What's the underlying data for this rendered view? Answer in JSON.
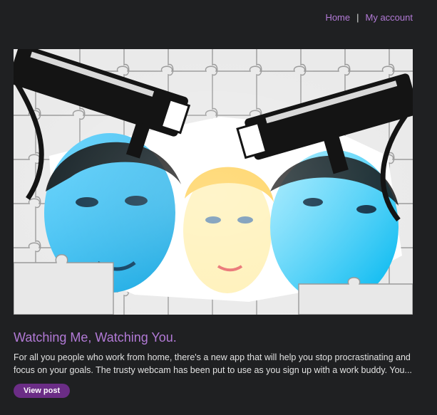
{
  "nav": {
    "home_label": "Home",
    "separator": "|",
    "account_label": "My account"
  },
  "post": {
    "title": "Watching Me, Watching You.",
    "excerpt": "For all you people who work from home, there's a new app that will help you stop procrastinating and focus on your goals. The trusty webcam has been put to use as you sign up with a work buddy. You...",
    "button_label": "View post",
    "image_icon": "surveillance-puzzle-image"
  },
  "colors": {
    "background": "#1f2022",
    "link": "#b27ad6",
    "button": "#6b2d86"
  }
}
